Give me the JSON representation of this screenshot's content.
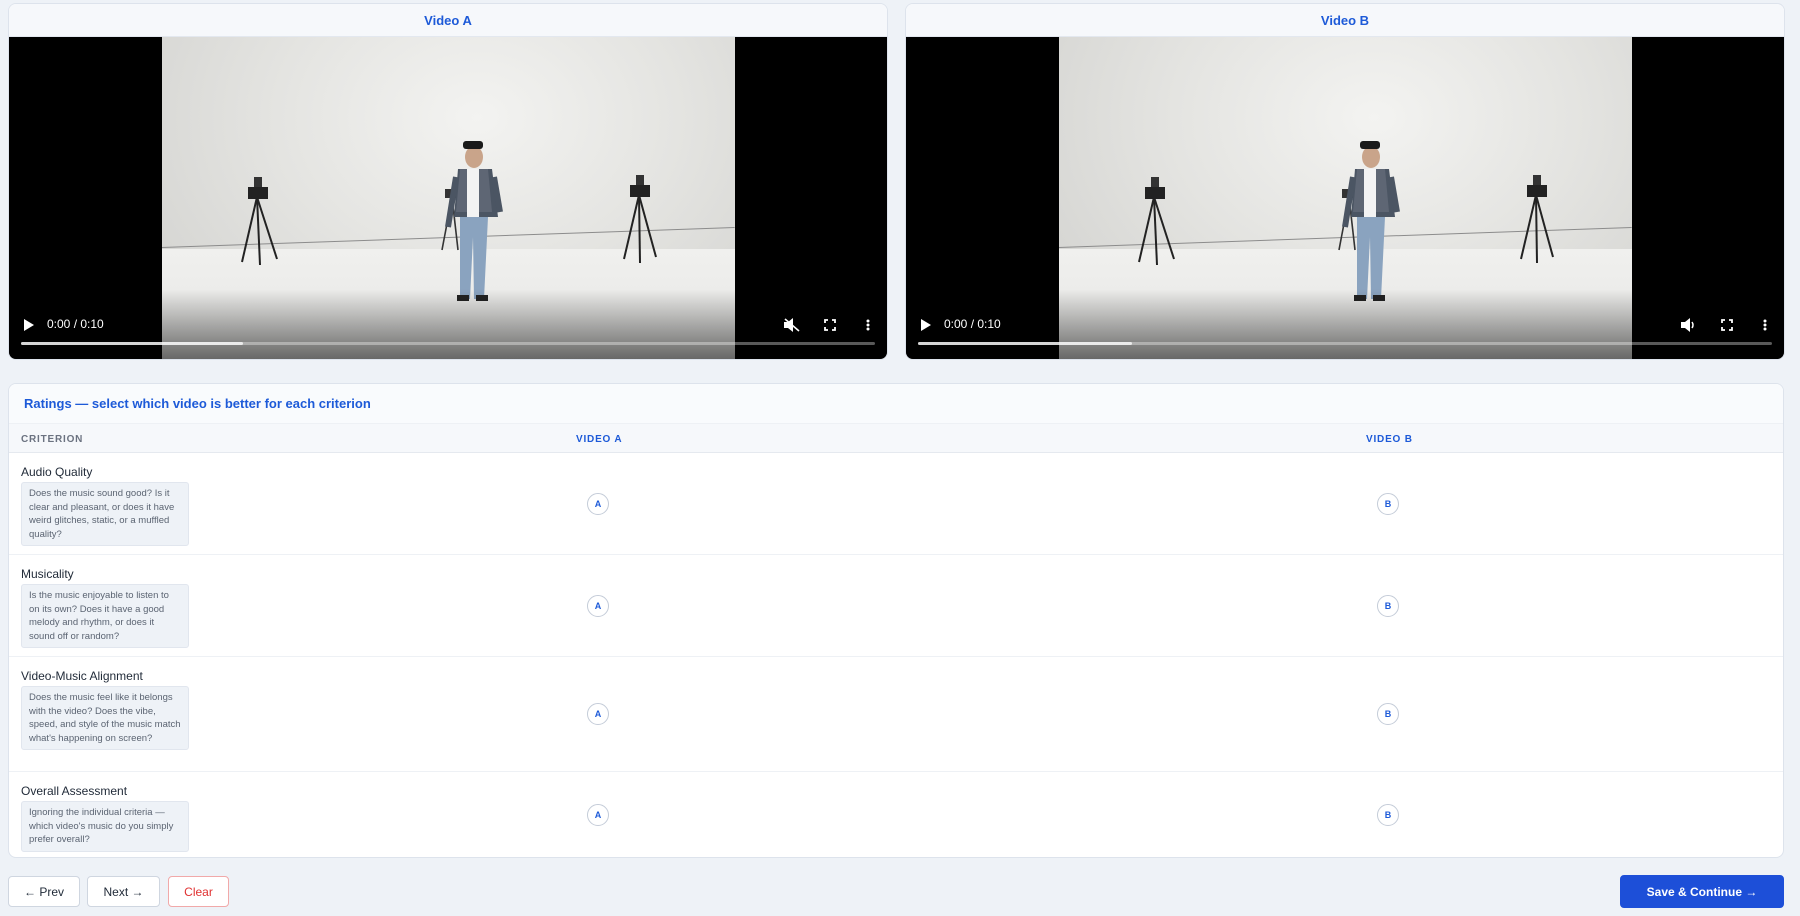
{
  "videos": {
    "a": {
      "title": "Video A",
      "time": "0:00 / 0:10",
      "muted": true,
      "buffered_fraction": 0.26,
      "icons": {
        "play": "play-icon",
        "volume": "muted-volume-icon",
        "fullscreen": "fullscreen-icon",
        "more": "more-options-icon"
      }
    },
    "b": {
      "title": "Video B",
      "time": "0:00 / 0:10",
      "muted": false,
      "buffered_fraction": 0.25,
      "icons": {
        "play": "play-icon",
        "volume": "volume-icon",
        "fullscreen": "fullscreen-icon",
        "more": "more-options-icon"
      }
    }
  },
  "ratings": {
    "title": "Ratings — select which video is better for each criterion",
    "headers": {
      "criterion": "CRITERION",
      "video_a": "VIDEO A",
      "video_b": "VIDEO B"
    },
    "choice_a_label": "A",
    "choice_b_label": "B",
    "criteria": [
      {
        "name": "Audio Quality",
        "description": "Does the music sound good? Is it clear and pleasant, or does it have weird glitches, static, or a muffled quality?"
      },
      {
        "name": "Musicality",
        "description": "Is the music enjoyable to listen to on its own? Does it have a good melody and rhythm, or does it sound off or random?"
      },
      {
        "name": "Video-Music Alignment",
        "description": "Does the music feel like it belongs with the video? Does the vibe, speed, and style of the music match what's happening on screen?"
      },
      {
        "name": "Overall Assessment",
        "description": "Ignoring the individual criteria — which video's music do you simply prefer overall?"
      }
    ]
  },
  "footer": {
    "prev_label": "← Prev",
    "next_label": "Next →",
    "clear_label": "Clear",
    "save_label": "Save & Continue →"
  },
  "colors": {
    "accent": "#1d4fd8",
    "clear": "#e03131",
    "background": "#eef2f7"
  }
}
